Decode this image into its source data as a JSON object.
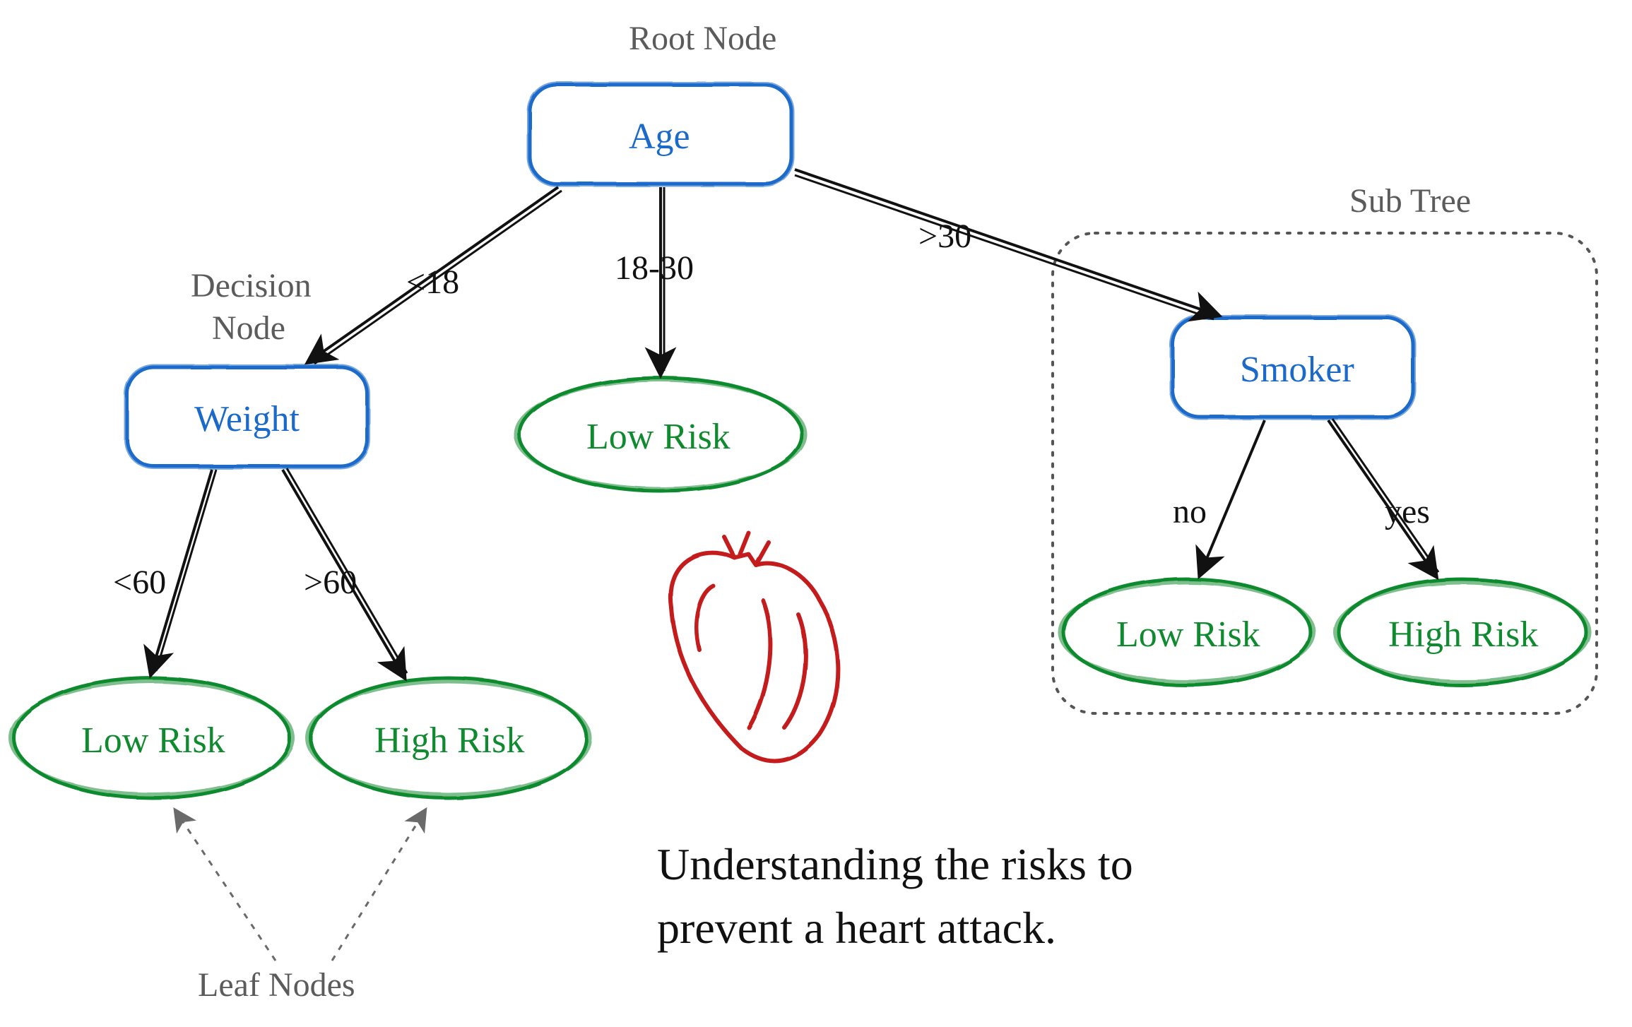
{
  "annotations": {
    "root_label": "Root Node",
    "decision_label_1": "Decision",
    "decision_label_2": "Node",
    "subtree_label": "Sub Tree",
    "leaf_label": "Leaf Nodes"
  },
  "nodes": {
    "age": "Age",
    "weight": "Weight",
    "smoker": "Smoker",
    "low_risk_center": "Low Risk",
    "low_risk_left": "Low Risk",
    "high_risk_left": "High Risk",
    "low_risk_right": "Low Risk",
    "high_risk_right": "High Risk"
  },
  "edges": {
    "age_lt18": "<18",
    "age_1830": "18-30",
    "age_gt30": ">30",
    "weight_lt60": "<60",
    "weight_gt60": ">60",
    "smoker_no": "no",
    "smoker_yes": "yes"
  },
  "caption_line1": "Understanding the risks to",
  "caption_line2": "prevent a heart attack."
}
